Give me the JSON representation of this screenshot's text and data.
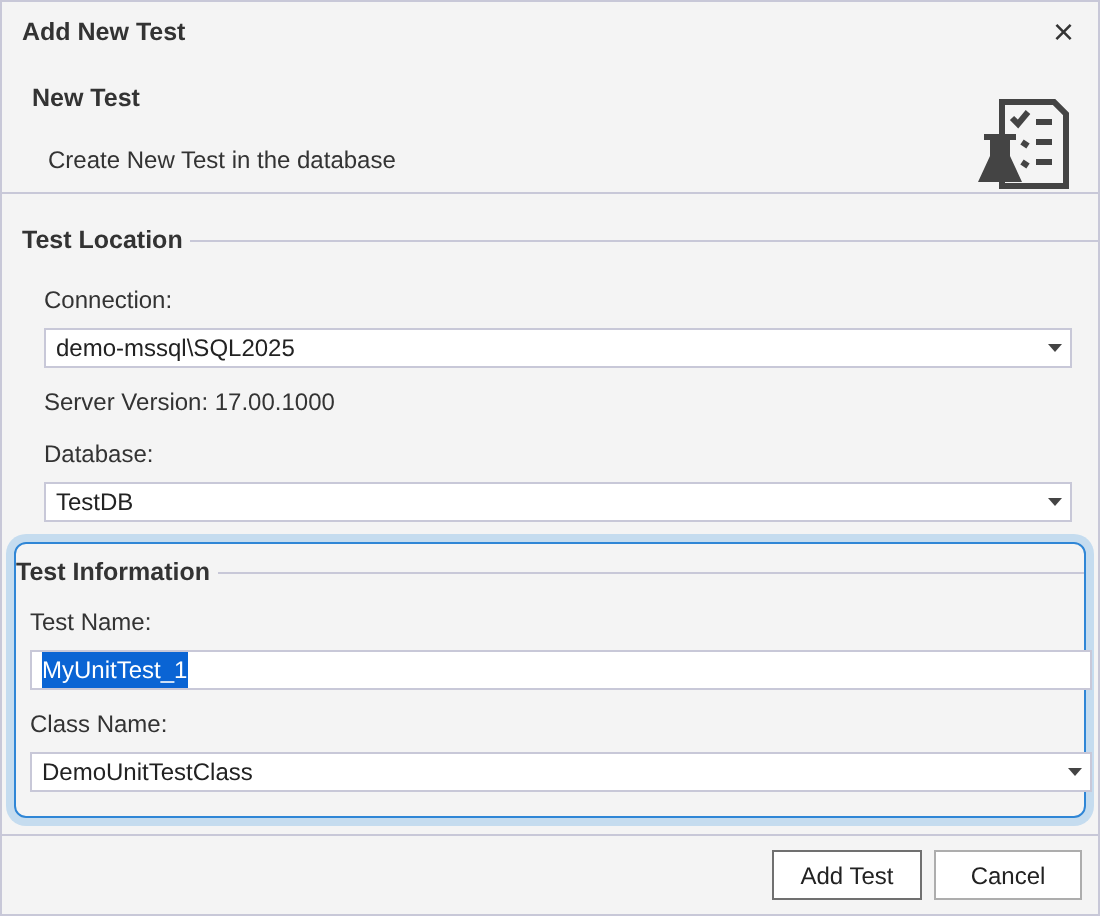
{
  "window": {
    "title": "Add New Test",
    "close": "×"
  },
  "header": {
    "title": "New Test",
    "subtitle": "Create New Test in the database"
  },
  "groups": [
    {
      "title": "Test Location",
      "focused": false,
      "items": [
        {
          "kind": "combo",
          "label": "Connection:",
          "value": "demo-mssql\\SQL2025"
        },
        {
          "kind": "text",
          "label": "Server Version: 17.00.1000"
        },
        {
          "kind": "combo",
          "label": "Database:",
          "value": "TestDB"
        }
      ]
    },
    {
      "title": "Test Information",
      "focused": true,
      "items": [
        {
          "kind": "input",
          "label": "Test Name:",
          "value": "MyUnitTest_1",
          "text_selected": true,
          "dropdown": false
        },
        {
          "kind": "input",
          "label": "Class Name:",
          "value": "DemoUnitTestClass",
          "text_selected": false,
          "dropdown": true
        }
      ]
    }
  ],
  "buttons": [
    {
      "label": "Add Test",
      "default": true
    },
    {
      "label": "Cancel",
      "default": false
    }
  ]
}
